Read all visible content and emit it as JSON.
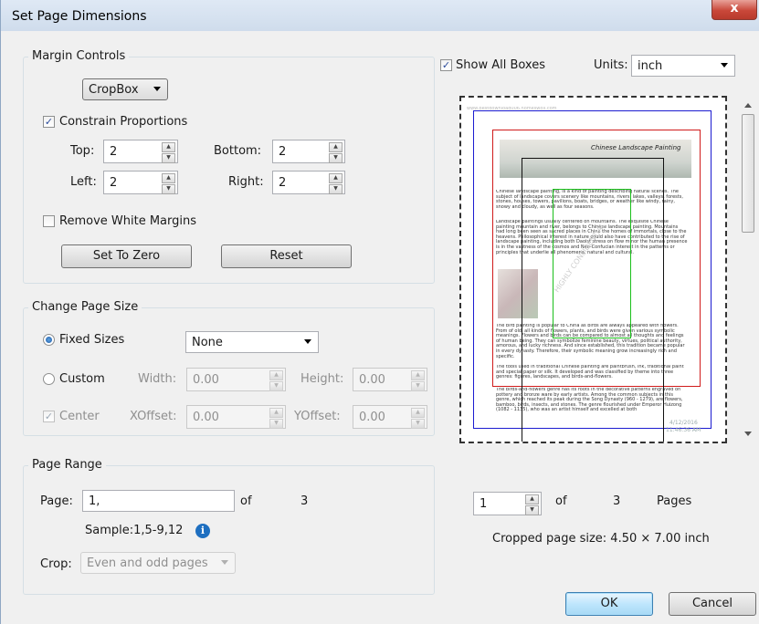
{
  "window": {
    "title": "Set Page Dimensions",
    "close_label": "x"
  },
  "margin_controls": {
    "group_label": "Margin Controls",
    "box_select": "CropBox",
    "constrain_label": "Constrain Proportions",
    "constrain_checked": true,
    "top_label": "Top:",
    "top_value": "2",
    "bottom_label": "Bottom:",
    "bottom_value": "2",
    "left_label": "Left:",
    "left_value": "2",
    "right_label": "Right:",
    "right_value": "2",
    "remove_white_label": "Remove White Margins",
    "remove_white_checked": false,
    "set_zero_label": "Set To Zero",
    "reset_label": "Reset"
  },
  "page_size": {
    "group_label": "Change Page Size",
    "fixed_label": "Fixed Sizes",
    "fixed_selected": true,
    "fixed_value": "None",
    "custom_label": "Custom",
    "width_label": "Width:",
    "width_value": "0.00",
    "height_label": "Height:",
    "height_value": "0.00",
    "center_label": "Center",
    "center_checked": true,
    "xoffset_label": "XOffset:",
    "xoffset_value": "0.00",
    "yoffset_label": "YOffset:",
    "yoffset_value": "0.00"
  },
  "page_range": {
    "group_label": "Page Range",
    "page_label": "Page:",
    "page_value": "1,",
    "of_label": "of",
    "total_pages": "3",
    "sample_text": "Sample:1,5-9,12",
    "crop_label": "Crop:",
    "crop_value": "Even and odd pages"
  },
  "preview": {
    "show_all_label": "Show All Boxes",
    "show_all_checked": true,
    "units_label": "Units:",
    "units_value": "inch",
    "page_current": "1",
    "of_label": "of",
    "page_total": "3",
    "pages_label": "Pages",
    "cropped_size_text": "Cropped page size:  4.50 × 7.00  inch",
    "doc_header": "Chinese Landscape Painting",
    "doc_para1": "Chinese landscape painting, is a kind of painting describing natural scenes. The subject of landscape covers scenery like mountains, rivers, lakes, valleys, forests, stones, houses, towers, pavilions, boats, bridges, or weather like windy, rainy, snowy and cloudy, as well as four seasons.",
    "doc_para2": "Landscape paintings usually centered on mountains. The exquisite Chinese painting mountain and river, belongs to Chinese landscape painting. Mountains had long been seen as sacred places in China the homes of immortals, close to the heavens. Philosophical interest in nature could also have contributed to the rise of landscape painting, including both Daoist stress on flow minor the human presence is in the vastness of the cosmos and Neo-Confucian interest in the patterns or principles that underlie all phenomena, natural and cultural.",
    "doc_para3": "The bird painting is popular to China as birds are always appeared with flowers. From of old, all kinds of flowers, plants, and birds were given various symbolic meanings. Flowers and birds can be compared to almost all thoughts and feelings of human being. They can symbolize feminine beauty, virtues, political authority, amorous, and lucky richness. And since established, this tradition became popular in every dynasty. Therefore, their symbolic meaning grow increasingly rich and specific.",
    "doc_para4": "The tools used in traditional Chinese painting are paintbrush, ink, traditional paint and special paper or silk. It developed and was classified by theme into three genres: figures, landscapes, and birds-and-flowers.",
    "doc_para5": "The birds-and-flowers genre has its roots in the decorative patterns engraved on pottery and bronze ware by early artists. Among the common subjects in this genre, which reached its peak during the Song Dynasty (960 - 1279), are flowers, bamboo, birds, insects, and stones. The genre flourished under Emperor Huizong (1082 - 1135), who was an artist himself and excelled at both",
    "doc_watermark_url": "www.bestdownload006.nomeswoil.com",
    "doc_watermark": "HIGHLY CONFIDENTIAL",
    "doc_stamp_date": "4/12/2016",
    "doc_stamp_time": "11:46:36 AM"
  },
  "buttons": {
    "ok_label": "OK",
    "cancel_label": "Cancel"
  },
  "colors": {
    "mediabox": "#1b1bd0",
    "cropbox": "#d01b1b",
    "bleedbox": "#1bbf1b",
    "trimbox": "#111111",
    "accent": "#1e6fc0"
  }
}
